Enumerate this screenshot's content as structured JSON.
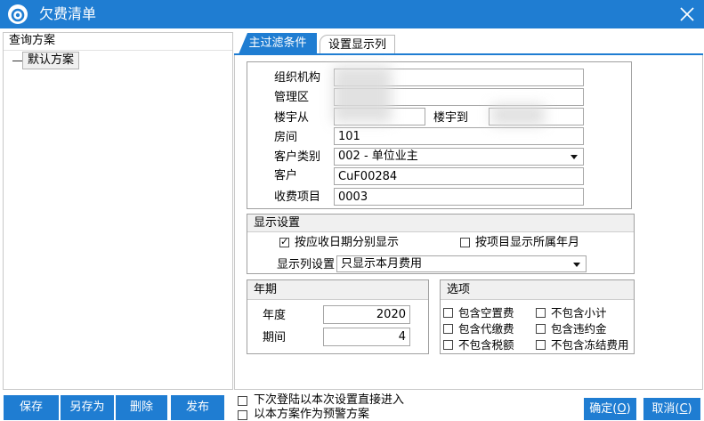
{
  "theme": {
    "accent": "#1f7dd2"
  },
  "icons": {
    "app": "app-logo-icon",
    "close": "close-icon",
    "dropdown": "chevron-down-icon",
    "checkbox": "checkbox-icon"
  },
  "window": {
    "title": "欠费清单"
  },
  "left_panel": {
    "header": "查询方案",
    "schemes": [
      {
        "label": "默认方案"
      }
    ]
  },
  "tabs": [
    {
      "label": "主过滤条件",
      "active": true
    },
    {
      "label": "设置显示列",
      "active": false
    }
  ],
  "filters": {
    "org": {
      "label": "组织机构",
      "value": ""
    },
    "area": {
      "label": "管理区",
      "value": ""
    },
    "building_from": {
      "label": "楼宇从",
      "value": ""
    },
    "building_to": {
      "label": "楼宇到",
      "value": ""
    },
    "room": {
      "label": "房间",
      "value": "101"
    },
    "customer_type": {
      "label": "客户类别",
      "value": "002 - 单位业主"
    },
    "customer": {
      "label": "客户",
      "value": "CuF00284"
    },
    "fee_item": {
      "label": "收费项目",
      "value": "0003"
    }
  },
  "display": {
    "header": "显示设置",
    "by_due_date": {
      "label": "按应收日期分别显示",
      "checked": true
    },
    "by_item_month": {
      "label": "按项目显示所属年月",
      "checked": false
    },
    "columns": {
      "label": "显示列设置",
      "value": "只显示本月费用"
    }
  },
  "period": {
    "header": "年期",
    "year": {
      "label": "年度",
      "value": "2020"
    },
    "period": {
      "label": "期间",
      "value": "4"
    }
  },
  "options": {
    "header": "选项",
    "items": [
      {
        "label": "包含空置费",
        "checked": false
      },
      {
        "label": "不包含小计",
        "checked": false
      },
      {
        "label": "包含代缴费",
        "checked": false
      },
      {
        "label": "包含违约金",
        "checked": false
      },
      {
        "label": "不包含税额",
        "checked": false
      },
      {
        "label": "不包含冻结费用",
        "checked": false
      }
    ]
  },
  "footer": {
    "save": "保存",
    "save_as": "另存为",
    "delete": "删除",
    "publish": "发布",
    "auto_enter": {
      "label": "下次登陆以本次设置直接进入",
      "checked": false
    },
    "warning_scheme": {
      "label": "以本方案作为预警方案",
      "checked": false
    },
    "ok": {
      "prefix": "确定(",
      "accel": "O",
      "suffix": ")"
    },
    "cancel": {
      "prefix": "取消(",
      "accel": "C",
      "suffix": ")"
    }
  }
}
